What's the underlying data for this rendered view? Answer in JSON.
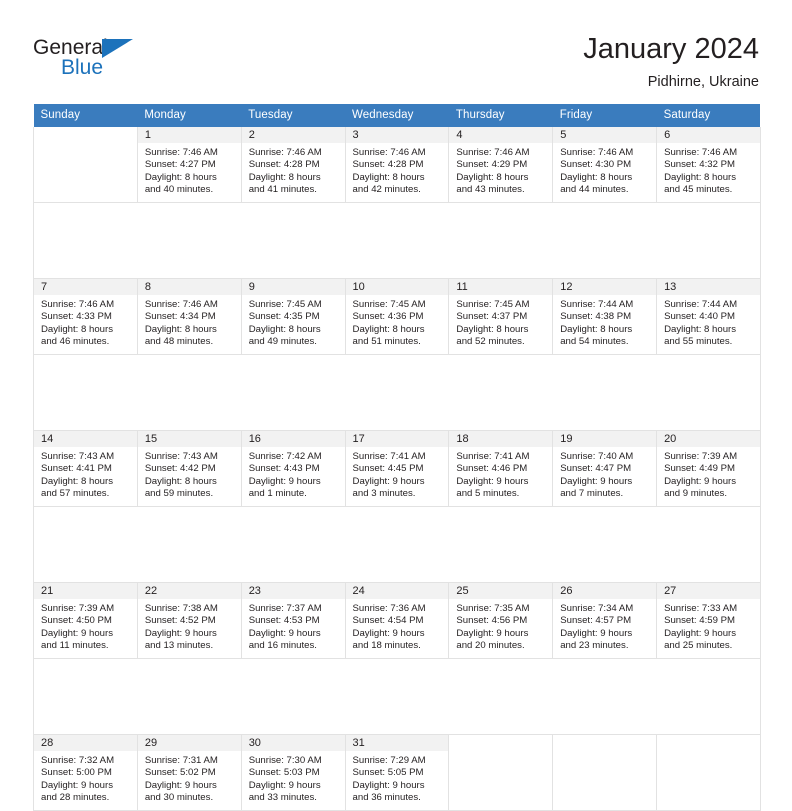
{
  "brand": {
    "name_part1": "General",
    "name_part2": "Blue",
    "logo_icon": "triangle-flag-icon"
  },
  "header": {
    "month_title": "January 2024",
    "location": "Pidhirne, Ukraine"
  },
  "colors": {
    "header_blue": "#3a7cbe",
    "brand_blue": "#1c72bb",
    "daynum_band": "#f2f2f2",
    "grid_border": "#e2e2e2",
    "text": "#231f20"
  },
  "weekday_headers": [
    "Sunday",
    "Monday",
    "Tuesday",
    "Wednesday",
    "Thursday",
    "Friday",
    "Saturday"
  ],
  "weeks": [
    [
      {
        "day": "",
        "lines": []
      },
      {
        "day": "1",
        "lines": [
          "Sunrise: 7:46 AM",
          "Sunset: 4:27 PM",
          "Daylight: 8 hours",
          "and 40 minutes."
        ]
      },
      {
        "day": "2",
        "lines": [
          "Sunrise: 7:46 AM",
          "Sunset: 4:28 PM",
          "Daylight: 8 hours",
          "and 41 minutes."
        ]
      },
      {
        "day": "3",
        "lines": [
          "Sunrise: 7:46 AM",
          "Sunset: 4:28 PM",
          "Daylight: 8 hours",
          "and 42 minutes."
        ]
      },
      {
        "day": "4",
        "lines": [
          "Sunrise: 7:46 AM",
          "Sunset: 4:29 PM",
          "Daylight: 8 hours",
          "and 43 minutes."
        ]
      },
      {
        "day": "5",
        "lines": [
          "Sunrise: 7:46 AM",
          "Sunset: 4:30 PM",
          "Daylight: 8 hours",
          "and 44 minutes."
        ]
      },
      {
        "day": "6",
        "lines": [
          "Sunrise: 7:46 AM",
          "Sunset: 4:32 PM",
          "Daylight: 8 hours",
          "and 45 minutes."
        ]
      }
    ],
    [
      {
        "day": "7",
        "lines": [
          "Sunrise: 7:46 AM",
          "Sunset: 4:33 PM",
          "Daylight: 8 hours",
          "and 46 minutes."
        ]
      },
      {
        "day": "8",
        "lines": [
          "Sunrise: 7:46 AM",
          "Sunset: 4:34 PM",
          "Daylight: 8 hours",
          "and 48 minutes."
        ]
      },
      {
        "day": "9",
        "lines": [
          "Sunrise: 7:45 AM",
          "Sunset: 4:35 PM",
          "Daylight: 8 hours",
          "and 49 minutes."
        ]
      },
      {
        "day": "10",
        "lines": [
          "Sunrise: 7:45 AM",
          "Sunset: 4:36 PM",
          "Daylight: 8 hours",
          "and 51 minutes."
        ]
      },
      {
        "day": "11",
        "lines": [
          "Sunrise: 7:45 AM",
          "Sunset: 4:37 PM",
          "Daylight: 8 hours",
          "and 52 minutes."
        ]
      },
      {
        "day": "12",
        "lines": [
          "Sunrise: 7:44 AM",
          "Sunset: 4:38 PM",
          "Daylight: 8 hours",
          "and 54 minutes."
        ]
      },
      {
        "day": "13",
        "lines": [
          "Sunrise: 7:44 AM",
          "Sunset: 4:40 PM",
          "Daylight: 8 hours",
          "and 55 minutes."
        ]
      }
    ],
    [
      {
        "day": "14",
        "lines": [
          "Sunrise: 7:43 AM",
          "Sunset: 4:41 PM",
          "Daylight: 8 hours",
          "and 57 minutes."
        ]
      },
      {
        "day": "15",
        "lines": [
          "Sunrise: 7:43 AM",
          "Sunset: 4:42 PM",
          "Daylight: 8 hours",
          "and 59 minutes."
        ]
      },
      {
        "day": "16",
        "lines": [
          "Sunrise: 7:42 AM",
          "Sunset: 4:43 PM",
          "Daylight: 9 hours",
          "and 1 minute."
        ]
      },
      {
        "day": "17",
        "lines": [
          "Sunrise: 7:41 AM",
          "Sunset: 4:45 PM",
          "Daylight: 9 hours",
          "and 3 minutes."
        ]
      },
      {
        "day": "18",
        "lines": [
          "Sunrise: 7:41 AM",
          "Sunset: 4:46 PM",
          "Daylight: 9 hours",
          "and 5 minutes."
        ]
      },
      {
        "day": "19",
        "lines": [
          "Sunrise: 7:40 AM",
          "Sunset: 4:47 PM",
          "Daylight: 9 hours",
          "and 7 minutes."
        ]
      },
      {
        "day": "20",
        "lines": [
          "Sunrise: 7:39 AM",
          "Sunset: 4:49 PM",
          "Daylight: 9 hours",
          "and 9 minutes."
        ]
      }
    ],
    [
      {
        "day": "21",
        "lines": [
          "Sunrise: 7:39 AM",
          "Sunset: 4:50 PM",
          "Daylight: 9 hours",
          "and 11 minutes."
        ]
      },
      {
        "day": "22",
        "lines": [
          "Sunrise: 7:38 AM",
          "Sunset: 4:52 PM",
          "Daylight: 9 hours",
          "and 13 minutes."
        ]
      },
      {
        "day": "23",
        "lines": [
          "Sunrise: 7:37 AM",
          "Sunset: 4:53 PM",
          "Daylight: 9 hours",
          "and 16 minutes."
        ]
      },
      {
        "day": "24",
        "lines": [
          "Sunrise: 7:36 AM",
          "Sunset: 4:54 PM",
          "Daylight: 9 hours",
          "and 18 minutes."
        ]
      },
      {
        "day": "25",
        "lines": [
          "Sunrise: 7:35 AM",
          "Sunset: 4:56 PM",
          "Daylight: 9 hours",
          "and 20 minutes."
        ]
      },
      {
        "day": "26",
        "lines": [
          "Sunrise: 7:34 AM",
          "Sunset: 4:57 PM",
          "Daylight: 9 hours",
          "and 23 minutes."
        ]
      },
      {
        "day": "27",
        "lines": [
          "Sunrise: 7:33 AM",
          "Sunset: 4:59 PM",
          "Daylight: 9 hours",
          "and 25 minutes."
        ]
      }
    ],
    [
      {
        "day": "28",
        "lines": [
          "Sunrise: 7:32 AM",
          "Sunset: 5:00 PM",
          "Daylight: 9 hours",
          "and 28 minutes."
        ]
      },
      {
        "day": "29",
        "lines": [
          "Sunrise: 7:31 AM",
          "Sunset: 5:02 PM",
          "Daylight: 9 hours",
          "and 30 minutes."
        ]
      },
      {
        "day": "30",
        "lines": [
          "Sunrise: 7:30 AM",
          "Sunset: 5:03 PM",
          "Daylight: 9 hours",
          "and 33 minutes."
        ]
      },
      {
        "day": "31",
        "lines": [
          "Sunrise: 7:29 AM",
          "Sunset: 5:05 PM",
          "Daylight: 9 hours",
          "and 36 minutes."
        ]
      },
      {
        "day": "",
        "lines": []
      },
      {
        "day": "",
        "lines": []
      },
      {
        "day": "",
        "lines": []
      }
    ]
  ]
}
